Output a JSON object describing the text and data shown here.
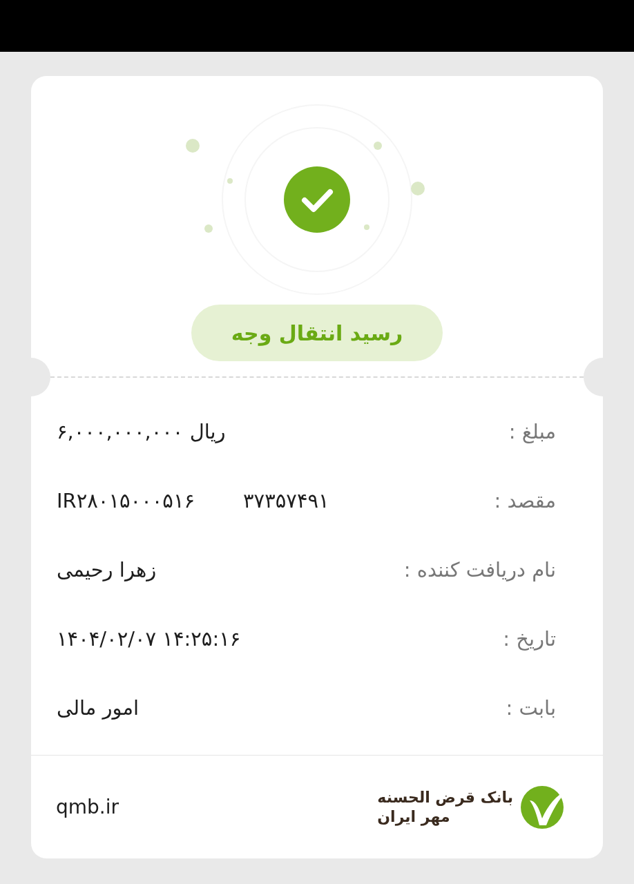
{
  "title": "رسید انتقال وجه",
  "rows": [
    {
      "label": "مبلغ :",
      "values": [
        "۶,۰۰۰,۰۰۰,۰۰۰ ریال"
      ]
    },
    {
      "label": "مقصد :",
      "values": [
        "۳۷۳۵۷۴۹۱",
        "IR۲۸۰۱۵۰۰۰۵۱۶"
      ]
    },
    {
      "label": "نام دریافت کننده :",
      "values": [
        "زهرا رحیمی"
      ]
    },
    {
      "label": "تاریخ :",
      "values": [
        "۱۴۰۴/۰۲/۰۷ ۱۴:۲۵:۱۶"
      ]
    },
    {
      "label": "بابت :",
      "values": [
        "امور مالی"
      ]
    }
  ],
  "footer": {
    "website": "qmb.ir",
    "bank_name": [
      "بانک قرض الحسنه",
      "مهر ایران"
    ]
  }
}
